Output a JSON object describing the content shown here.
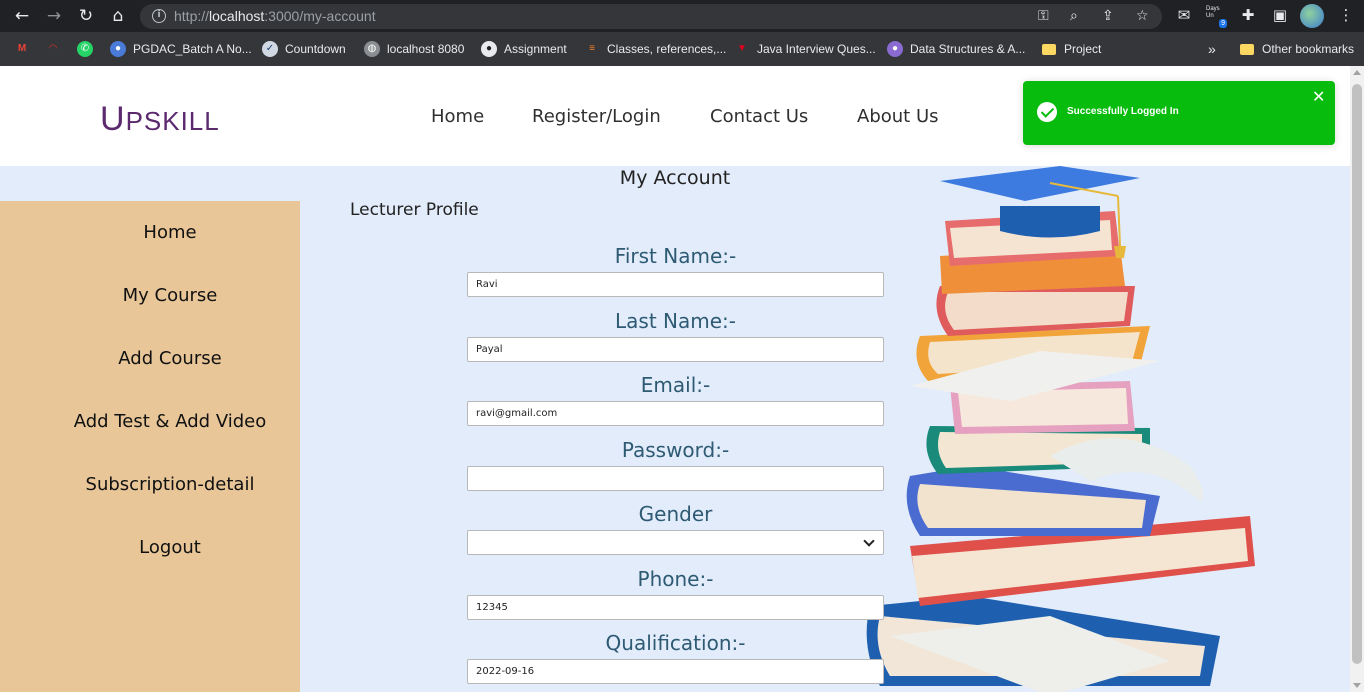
{
  "browser": {
    "url_prefix": "http://",
    "url_host": "localhost",
    "url_rest": ":3000/my-account",
    "days_badge_label": "Days Un",
    "days_badge_count": "9",
    "bookmarks": [
      {
        "label": "PGDAC_Batch A No..."
      },
      {
        "label": "Countdown"
      },
      {
        "label": "localhost 8080"
      },
      {
        "label": "Assignment"
      },
      {
        "label": "Classes, references,..."
      },
      {
        "label": "Java Interview Ques..."
      },
      {
        "label": "Data Structures & A..."
      },
      {
        "label": "Project"
      }
    ],
    "overflow_label": "»",
    "other_bookmarks": "Other bookmarks"
  },
  "header": {
    "logo_first": "U",
    "logo_rest": "PSKILL",
    "nav": [
      "Home",
      "Register/Login",
      "Contact Us",
      "About Us"
    ]
  },
  "toast": {
    "message": "Successfully Logged In",
    "close": "✕",
    "color": "#07bc0c"
  },
  "sidebar": {
    "items": [
      "Home",
      "My Course",
      "Add Course",
      "Add Test & Add Video",
      "Subscription-detail",
      "Logout"
    ]
  },
  "main": {
    "title": "My Account",
    "subtitle": "Lecturer Profile",
    "fields": [
      {
        "label": "First Name:-",
        "value": "Ravi"
      },
      {
        "label": "Last Name:-",
        "value": "Payal"
      },
      {
        "label": "Email:-",
        "value": "ravi@gmail.com"
      },
      {
        "label": "Password:-",
        "value": ""
      },
      {
        "label": "Gender",
        "value": ""
      },
      {
        "label": "Phone:-",
        "value": "12345"
      },
      {
        "label": "Qualification:-",
        "value": "2022-09-16"
      }
    ]
  },
  "colors": {
    "logo": "#5b2a6e",
    "sidebar_bg": "#e8c698",
    "page_bg": "#e2ecfa",
    "label": "#2e5a73"
  }
}
